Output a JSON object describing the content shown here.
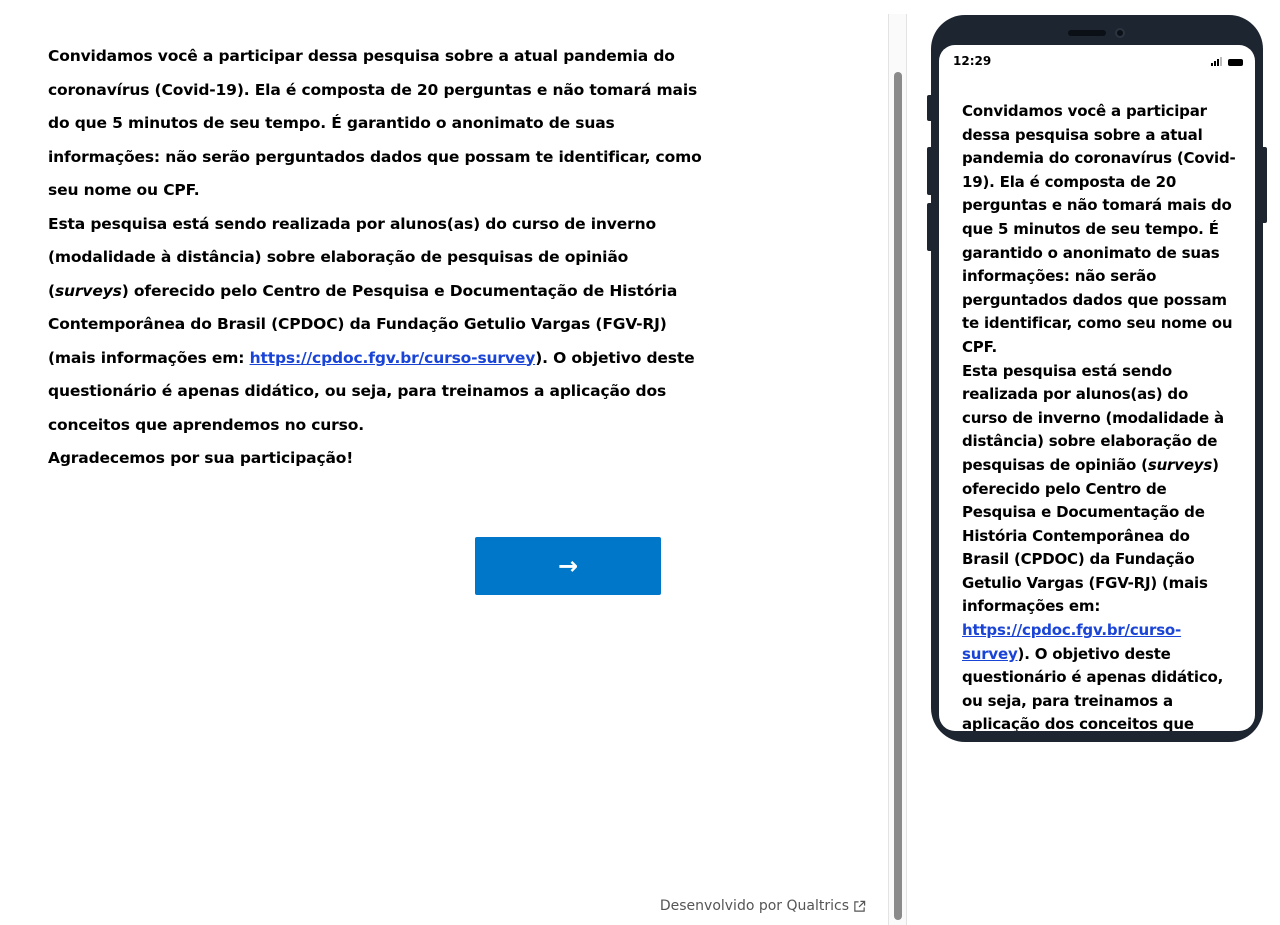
{
  "survey": {
    "intro_p1": "Convidamos você a participar dessa pesquisa sobre a atual pandemia do coronavírus (Covid-19). Ela é composta de 20 perguntas e não tomará mais do que 5 minutos de seu tempo. É garantido o anonimato de suas informações: não serão perguntados dados que possam te identificar, como seu nome ou CPF.",
    "intro_p2_before_italic": "Esta pesquisa está sendo realizada por alunos(as) do curso de inverno (modalidade à distância) sobre elaboração de pesquisas de opinião (",
    "intro_p2_italic": "surveys",
    "intro_p2_after_italic": ") oferecido pelo Centro de Pesquisa e Documentação de História Contemporânea do Brasil (CPDOC) da Fundação Getulio Vargas (FGV-RJ) (mais informações em: ",
    "link_text": "https://cpdoc.fgv.br/curso-survey",
    "intro_p2_after_link": "). O objetivo deste questionário é apenas didático, ou seja, para treinamos a aplicação dos conceitos que aprendemos no curso.",
    "intro_p3": "Agradecemos por sua participação!",
    "next_button_label": "→",
    "next_button_color": "#0077c8",
    "link_color": "#1a44d6"
  },
  "footer": {
    "text": "Desenvolvido por Qualtrics",
    "icon": "external-link-icon"
  },
  "phone_preview": {
    "status_time": "12:29",
    "icons": [
      "signal-icon",
      "battery-icon"
    ]
  }
}
